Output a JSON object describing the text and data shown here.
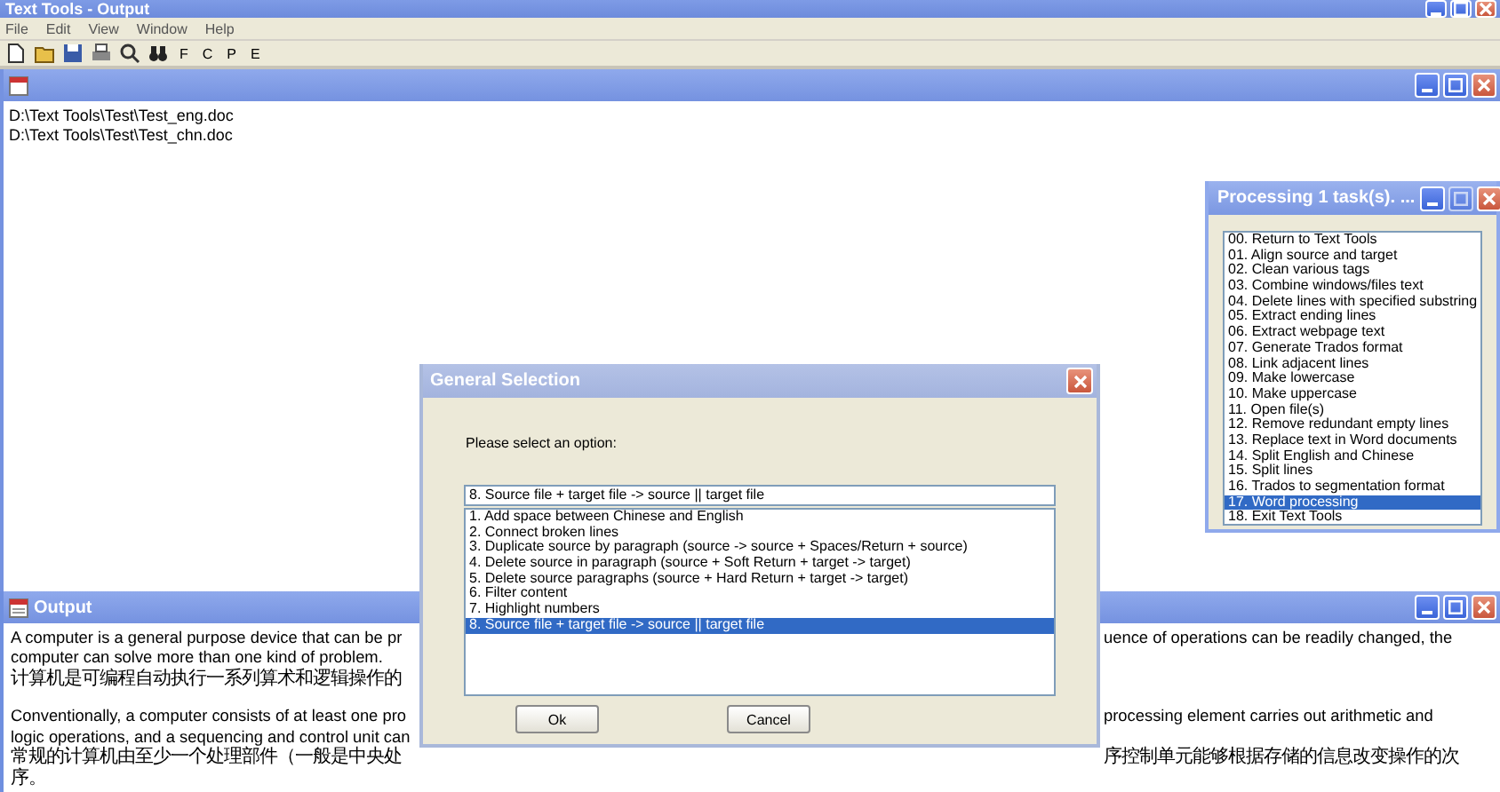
{
  "app": {
    "title": "Text Tools - Output",
    "menu": [
      "File",
      "Edit",
      "View",
      "Window",
      "Help"
    ],
    "toolbar_letters": [
      "F",
      "C",
      "P",
      "E"
    ]
  },
  "document_window": {
    "lines": [
      "D:\\Text Tools\\Test\\Test_eng.doc",
      "D:\\Text Tools\\Test\\Test_chn.doc"
    ]
  },
  "output_window": {
    "title": "Output",
    "paragraphs": [
      {
        "lines": [
          {
            "left": "A computer is a general purpose device that can be pr",
            "right": "uence of operations can be readily changed, the"
          },
          {
            "left": "computer can solve more than one kind of problem."
          },
          {
            "left": "计算机是可编程自动执行一系列算术和逻辑操作的"
          }
        ]
      },
      {
        "lines": [
          {
            "left": "Conventionally, a computer consists of at least one pro",
            "right": "processing element carries out arithmetic and"
          },
          {
            "left": "logic operations, and a sequencing and control unit can"
          },
          {
            "left": "常规的计算机由至少一个处理部件（一般是中央处",
            "right": "序控制单元能够根据存储的信息改变操作的次"
          },
          {
            "left": "序。"
          }
        ]
      }
    ]
  },
  "processing_window": {
    "title": "Processing 1 task(s). ...",
    "items": [
      {
        "label": "00. Return to Text Tools",
        "selected": false
      },
      {
        "label": "01. Align source and target",
        "selected": false
      },
      {
        "label": "02. Clean various tags",
        "selected": false
      },
      {
        "label": "03. Combine windows/files text",
        "selected": false
      },
      {
        "label": "04. Delete lines with specified substring",
        "selected": false
      },
      {
        "label": "05. Extract ending lines",
        "selected": false
      },
      {
        "label": "06. Extract webpage text",
        "selected": false
      },
      {
        "label": "07. Generate Trados format",
        "selected": false
      },
      {
        "label": "08. Link adjacent lines",
        "selected": false
      },
      {
        "label": "09. Make lowercase",
        "selected": false
      },
      {
        "label": "10. Make uppercase",
        "selected": false
      },
      {
        "label": "11. Open file(s)",
        "selected": false
      },
      {
        "label": "12. Remove redundant empty lines",
        "selected": false
      },
      {
        "label": "13. Replace text in Word documents",
        "selected": false
      },
      {
        "label": "14. Split English and Chinese",
        "selected": false
      },
      {
        "label": "15. Split lines",
        "selected": false
      },
      {
        "label": "16. Trados to segmentation format",
        "selected": false
      },
      {
        "label": "17. Word processing",
        "selected": true
      },
      {
        "label": "18. Exit Text Tools",
        "selected": false
      }
    ]
  },
  "dialog": {
    "title": "General Selection",
    "prompt": "Please select an option:",
    "field_value": "8. Source file + target file -> source || target file",
    "options": [
      {
        "label": "1. Add space between Chinese and English",
        "selected": false
      },
      {
        "label": "2. Connect broken lines",
        "selected": false
      },
      {
        "label": "3. Duplicate source by paragraph (source -> source + Spaces/Return + source)",
        "selected": false
      },
      {
        "label": "4. Delete source in paragraph (source + Soft Return + target -> target)",
        "selected": false
      },
      {
        "label": "5. Delete source paragraphs (source + Hard Return + target -> target)",
        "selected": false
      },
      {
        "label": "6. Filter content",
        "selected": false
      },
      {
        "label": "7. Highlight numbers",
        "selected": false
      },
      {
        "label": "8. Source file + target file -> source || target file",
        "selected": true
      }
    ],
    "buttons": [
      "Ok",
      "Cancel"
    ]
  }
}
